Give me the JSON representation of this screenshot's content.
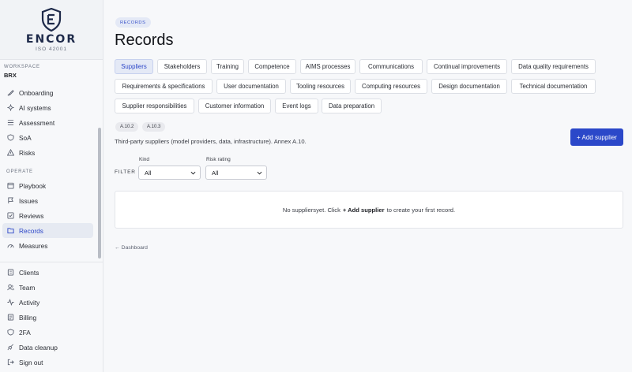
{
  "brand": {
    "name": "ENCOR",
    "subtitle": "ISO 42001"
  },
  "workspace": {
    "label": "WORKSPACE",
    "name": "BRX"
  },
  "nav": {
    "top": [
      {
        "label": "Onboarding",
        "icon": "onboarding-icon"
      },
      {
        "label": "AI systems",
        "icon": "ai-systems-icon"
      },
      {
        "label": "Assessment",
        "icon": "assessment-icon"
      },
      {
        "label": "SoA",
        "icon": "soa-icon"
      },
      {
        "label": "Risks",
        "icon": "risks-icon"
      }
    ],
    "operate_label": "OPERATE",
    "operate": [
      {
        "label": "Playbook",
        "icon": "playbook-icon"
      },
      {
        "label": "Issues",
        "icon": "issues-icon"
      },
      {
        "label": "Reviews",
        "icon": "reviews-icon"
      },
      {
        "label": "Records",
        "icon": "records-icon",
        "active": true
      },
      {
        "label": "Measures",
        "icon": "measures-icon"
      }
    ],
    "bottom": [
      {
        "label": "Clients",
        "icon": "clients-icon"
      },
      {
        "label": "Team",
        "icon": "team-icon"
      },
      {
        "label": "Activity",
        "icon": "activity-icon"
      },
      {
        "label": "Billing",
        "icon": "billing-icon"
      },
      {
        "label": "2FA",
        "icon": "shield-icon"
      },
      {
        "label": "Data cleanup",
        "icon": "cleanup-icon"
      },
      {
        "label": "Sign out",
        "icon": "sign-out-icon"
      }
    ]
  },
  "header": {
    "breadcrumb": "RECORDS",
    "title": "Records"
  },
  "tabs": [
    "Suppliers",
    "Stakeholders",
    "Training",
    "Competence",
    "AIMS processes",
    "Communications",
    "Continual improvements",
    "Data quality requirements",
    "Requirements & specifications",
    "User documentation",
    "Tooling resources",
    "Computing resources",
    "Design documentation",
    "Technical documentation",
    "Supplier responsibilities",
    "Customer information",
    "Event logs",
    "Data preparation"
  ],
  "active_tab": "Suppliers",
  "refs": [
    "A.10.2",
    "A.10.3"
  ],
  "description": "Third-party suppliers (model providers, data, infrastructure). Annex A.10.",
  "add_button": "+ Add supplier",
  "filter": {
    "label": "FILTER",
    "kind": {
      "caption": "Kind",
      "value": "All"
    },
    "risk": {
      "caption": "Risk rating",
      "value": "All"
    }
  },
  "empty_state": {
    "before": "No suppliersyet. Click",
    "action": "+ Add supplier",
    "after": "to create your first record."
  },
  "back_link": "← Dashboard",
  "colors": {
    "accent": "#2b48c9",
    "active_bg": "#e4e9f6"
  }
}
